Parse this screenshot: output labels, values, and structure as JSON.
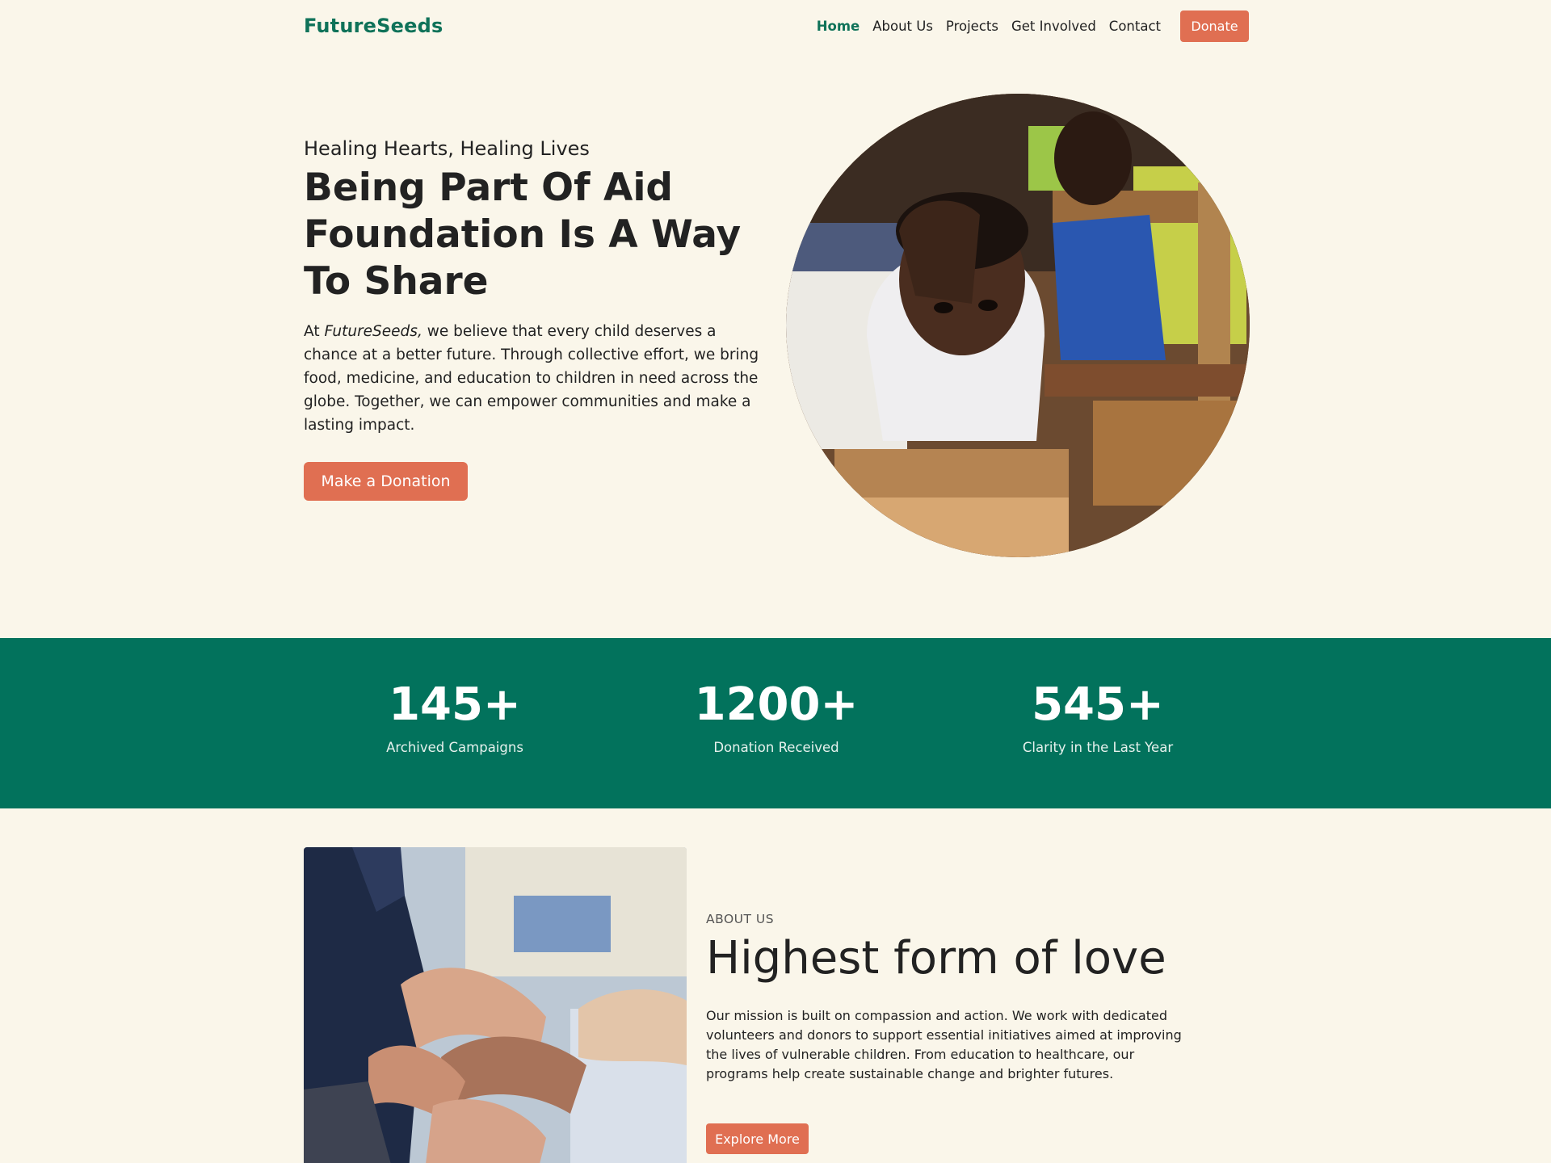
{
  "nav": {
    "brand": "FutureSeeds",
    "links": [
      "Home",
      "About Us",
      "Projects",
      "Get Involved",
      "Contact"
    ],
    "donate_label": "Donate"
  },
  "hero": {
    "subtitle": "Healing Hearts, Healing Lives",
    "title": "Being Part Of Aid Foundation Is A Way To Share",
    "text_prefix": "At ",
    "text_brand": "FutureSeeds,",
    "text_rest": " we believe that every child deserves a chance at a better future. Through collective effort, we bring food, medicine, and education to children in need across the globe. Together, we can empower communities and make a lasting impact.",
    "cta_label": "Make a Donation"
  },
  "stats": [
    {
      "value": "145+",
      "label": "Archived Campaigns"
    },
    {
      "value": "1200+",
      "label": "Donation Received"
    },
    {
      "value": "545+",
      "label": "Clarity in the Last Year"
    }
  ],
  "about": {
    "eyebrow": "ABOUT US",
    "title": "Highest form of love",
    "text": "Our mission is built on compassion and action. We work with dedicated volunteers and donors to support essential initiatives aimed at improving the lives of vulnerable children. From education to healthcare, our programs help create sustainable change and brighter futures.",
    "button_label": "Explore More"
  },
  "colors": {
    "brand_green": "#0f7259",
    "stats_band": "#02725c",
    "accent_coral": "#e06f52",
    "background": "#faf6ea"
  }
}
